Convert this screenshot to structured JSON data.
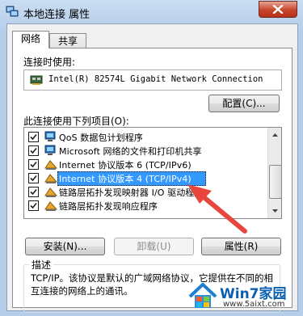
{
  "window": {
    "title": "本地连接 属性",
    "tabs": [
      {
        "label": "网络",
        "active": true
      },
      {
        "label": "共享",
        "active": false
      }
    ]
  },
  "connection": {
    "connect_using_label": "连接时使用:",
    "adapter_name": "Intel(R) 82574L Gigabit Network Connection",
    "configure_button": "配置(C)..."
  },
  "items": {
    "label": "此连接使用下列项目(O):",
    "list": [
      {
        "label": "QoS 数据包计划程序",
        "checked": true,
        "icon": "qos-scheduler-icon"
      },
      {
        "label": "Microsoft 网络的文件和打印机共享",
        "checked": true,
        "icon": "file-printer-sharing-icon"
      },
      {
        "label": "Internet 协议版本 6 (TCP/IPv6)",
        "checked": true,
        "icon": "protocol-icon"
      },
      {
        "label": "Internet 协议版本 4 (TCP/IPv4)",
        "checked": true,
        "icon": "protocol-icon",
        "selected": true
      },
      {
        "label": "链路层拓扑发现映射器 I/O 驱动程序",
        "checked": true,
        "icon": "protocol-icon"
      },
      {
        "label": "链路层拓扑发现响应程序",
        "checked": true,
        "icon": "protocol-icon"
      }
    ]
  },
  "buttons": {
    "install": "安装(N)...",
    "uninstall": "卸载(U)",
    "properties": "属性(R)"
  },
  "description": {
    "legend": "描述",
    "text": "TCP/IP。该协议是默认的广域网络协议，它提供在不同的相互连接的网络上的通讯。"
  },
  "watermark": {
    "name": "Win7家园",
    "url": "www.5aixt.com"
  },
  "colors": {
    "selection": "#3399ff",
    "annotation_arrow": "#e8463c",
    "close_button": "#c7452d"
  }
}
